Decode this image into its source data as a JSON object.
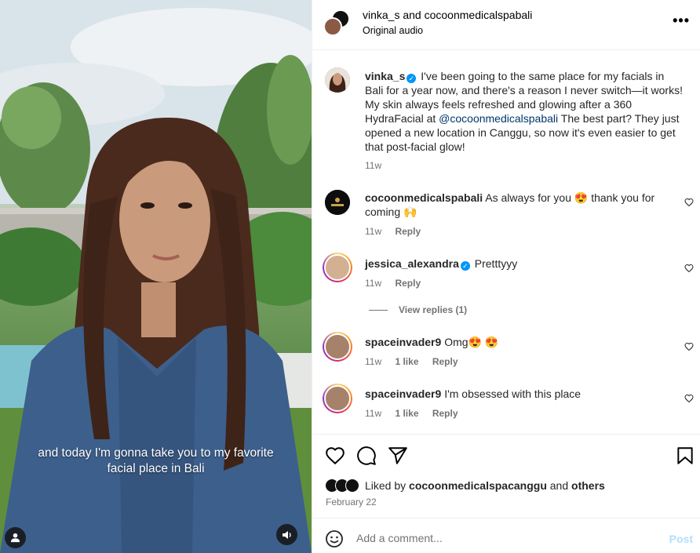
{
  "media": {
    "caption_line1": "and today I'm gonna take you to my favorite",
    "caption_line2": "facial place in Bali",
    "user_icon": "user-icon",
    "sound_icon": "speaker-icon"
  },
  "header": {
    "title": "vinka_s and cocoonmedicalspabali",
    "subtitle": "Original audio",
    "more_icon": "more-options-icon"
  },
  "post": {
    "author": "vinka_s",
    "text_before_mention": "I've been going to the same place for my facials in Bali for a year now, and there's a reason I never switch—it works! My skin always feels refreshed and glowing after a 360 HydraFacial at",
    "mention": "@cocoonmedicalspabali",
    "text_after_mention": "The best part? They just opened a new location in Canggu, so now it's even easier to get that post-facial glow!",
    "time": "11w"
  },
  "comments": [
    {
      "user": "cocoonmedicalspabali",
      "text": "As always for you 😍 thank you for coming 🙌",
      "time": "11w",
      "likes": "",
      "reply": "Reply"
    },
    {
      "user": "jessica_alexandra",
      "text": "Pretttyyy",
      "time": "11w",
      "likes": "",
      "reply": "Reply"
    },
    {
      "user": "spaceinvader9",
      "text": "Omg😍 😍",
      "time": "11w",
      "likes": "1 like",
      "reply": "Reply"
    },
    {
      "user": "spaceinvader9",
      "text": "I'm obsessed with this place",
      "time": "11w",
      "likes": "1 like",
      "reply": "Reply"
    }
  ],
  "view_replies": "View replies (1)",
  "footer": {
    "liked_prefix": "Liked by",
    "liked_user": "cocoonmedicalspacanggu",
    "liked_and": "and",
    "liked_others": "others",
    "date": "February 22"
  },
  "comment_input": {
    "placeholder": "Add a comment...",
    "post_label": "Post"
  },
  "colors": {
    "link": "#00376b",
    "verified": "#0095f6",
    "post_disabled": "#b2dffc",
    "muted": "#737373"
  }
}
